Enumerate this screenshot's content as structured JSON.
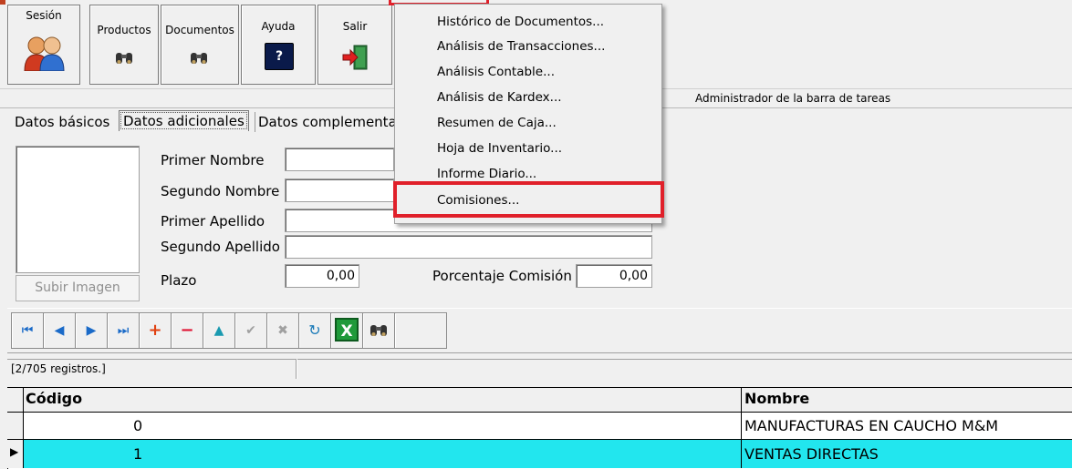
{
  "toolbar": {
    "sesion": "Sesión",
    "productos": "Productos",
    "documentos": "Documentos",
    "ayuda": "Ayuda",
    "salir": "Salir"
  },
  "strip": {
    "taskbar_admin": "Administrador de la barra de tareas"
  },
  "tabs": [
    "Datos básicos",
    "Datos adicionales",
    "Datos complementa"
  ],
  "form": {
    "primer_nombre": "Primer Nombre",
    "segundo_nombre": "Segundo Nombre",
    "primer_apellido": "Primer Apellido",
    "segundo_apellido": "Segundo Apellido",
    "plazo": "Plazo",
    "plazo_value": "0,00",
    "porcentaje_comision": "Porcentaje Comisión",
    "porcentaje_value": "0,00",
    "subir_imagen": "Subir Imagen"
  },
  "status": {
    "records": "[2/705 registros.]"
  },
  "grid": {
    "headers": [
      "Código",
      "Nombre"
    ],
    "rows": [
      {
        "codigo": "0",
        "nombre": "MANUFACTURAS EN CAUCHO M&M"
      },
      {
        "codigo": "1",
        "nombre": "VENTAS DIRECTAS"
      }
    ]
  },
  "menu": {
    "items": [
      "Histórico de Documentos...",
      "Análisis de Transacciones...",
      "Análisis Contable...",
      "Análisis de Kardex...",
      "Resumen de Caja...",
      "Hoja de Inventario...",
      "Informe Diario...",
      "Comisiones..."
    ],
    "highlight_color": "#e0202a"
  }
}
